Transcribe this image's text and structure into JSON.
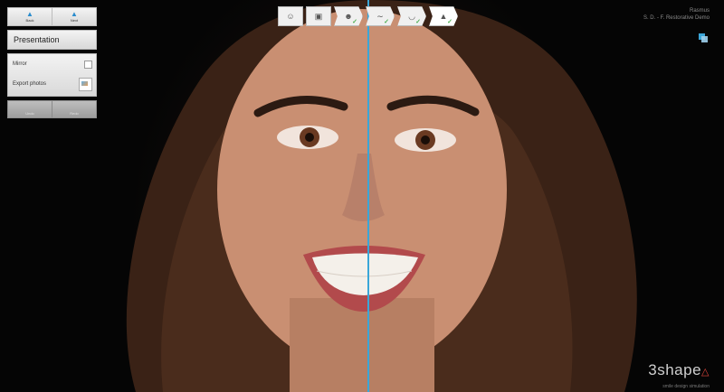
{
  "nav": {
    "back": "Back",
    "next": "Next"
  },
  "panel": {
    "title": "Presentation",
    "mirror_label": "Mirror",
    "export_label": "Export photos"
  },
  "history": {
    "undo": "Undo",
    "redo": "Redo"
  },
  "case": {
    "user": "Rasmus",
    "name": "S. D. - F. Restorative Demo"
  },
  "logo": {
    "brand": "3shape",
    "tagline": "smile design simulation"
  },
  "toolbar_steps": [
    {
      "icon": "face-icon",
      "done": false
    },
    {
      "icon": "photo-icon",
      "done": false
    },
    {
      "icon": "face-profile-icon",
      "done": true
    },
    {
      "icon": "teeth-line-icon",
      "done": true
    },
    {
      "icon": "smile-icon",
      "done": true
    },
    {
      "icon": "tooth-icon",
      "done": true
    }
  ],
  "colors": {
    "accent": "#2a8ccd",
    "midline": "#3aa6d8",
    "check": "#4caf50",
    "logo_red": "#e0463c"
  }
}
